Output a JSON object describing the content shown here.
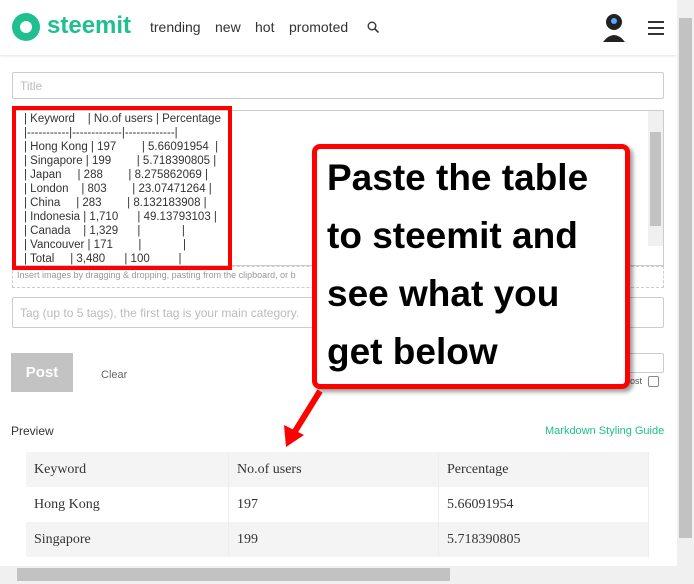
{
  "header": {
    "logo": "steemit",
    "nav": [
      "trending",
      "new",
      "hot",
      "promoted"
    ],
    "search_icon": "search-icon",
    "menu_icon": "hamburger-icon"
  },
  "editor": {
    "title_placeholder": "Title",
    "markdown_lines": [
      "| Keyword    | No.of users | Percentage  |",
      "|-----------|-------------|-------------|",
      "| Hong Kong | 197        | 5.66091954  |",
      "| Singapore | 199        | 5.718390805 |",
      "| Japan     | 288        | 8.275862069 |",
      "| London    | 803        | 23.07471264 |",
      "| China     | 283        | 8.132183908 |",
      "| Indonesia | 1,710      | 49.13793103 |",
      "| Canada    | 1,329      |             |",
      "| Vancouver | 171        |             |",
      "| Total     | 3,480      | 100         |"
    ],
    "hint": "Insert images by dragging & dropping, pasting from the clipboard, or b",
    "tag_placeholder": "Tag (up to 5 tags), the first tag is your main category.",
    "post": "Post",
    "clear": "Clear",
    "checkbox_label": "ost"
  },
  "preview": {
    "label": "Preview",
    "guide": "Markdown Styling Guide",
    "headers": [
      "Keyword",
      "No.of users",
      "Percentage"
    ],
    "rows": [
      [
        "Hong Kong",
        "197",
        "5.66091954"
      ],
      [
        "Singapore",
        "199",
        "5.718390805"
      ]
    ]
  },
  "callout": {
    "lines": [
      "Paste the table",
      "to steemit and",
      "see what you",
      "get below"
    ],
    "color": "#ff0000"
  },
  "colors": {
    "brand": "#1fbf8f"
  }
}
